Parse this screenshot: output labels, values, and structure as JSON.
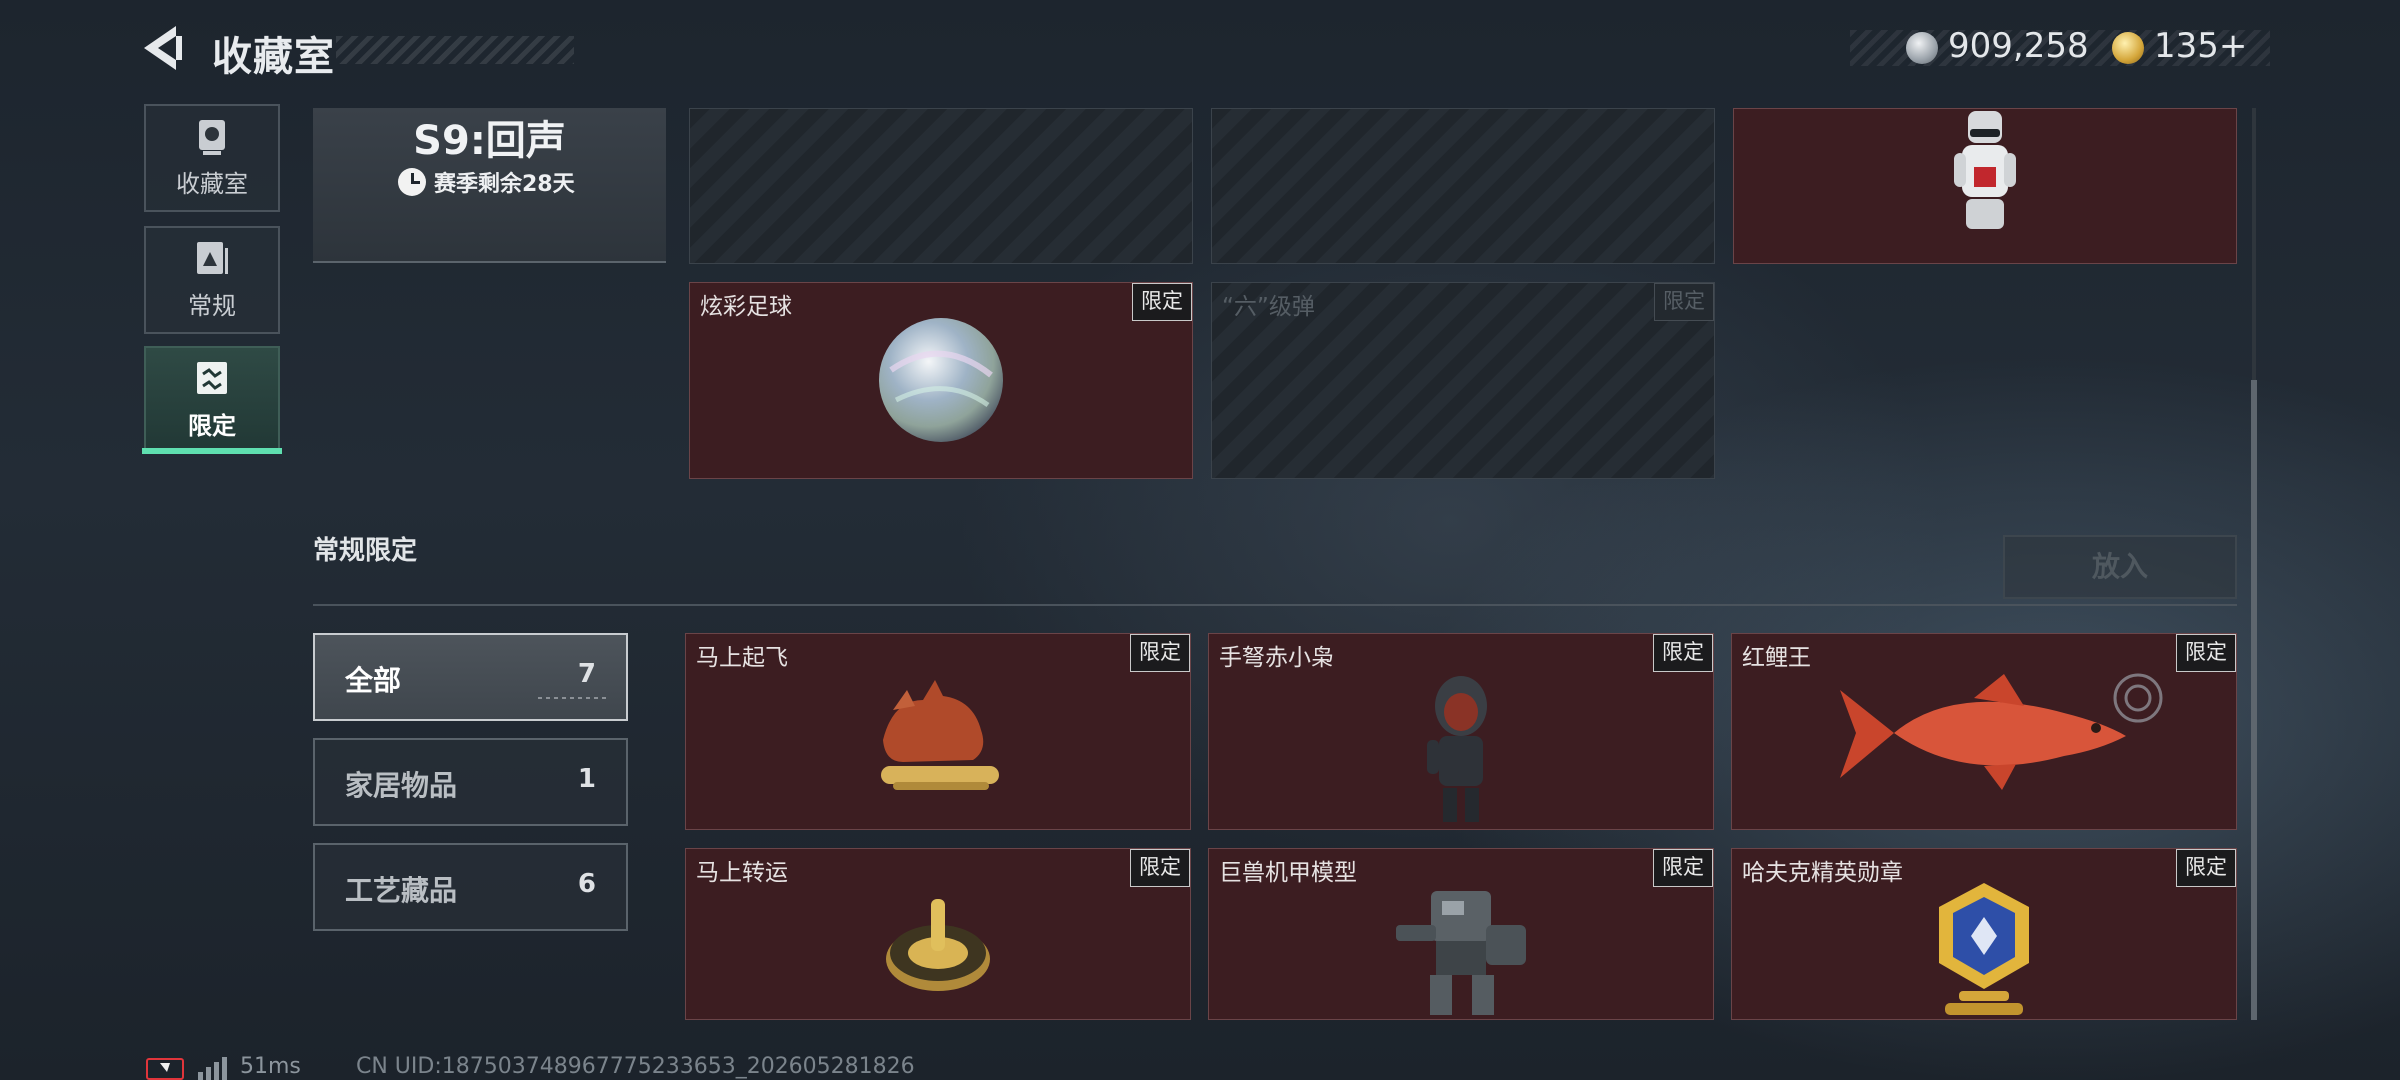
{
  "header": {
    "title": "收藏室"
  },
  "currency": {
    "silver": {
      "icon": "silver-coin-icon",
      "value": "909,258"
    },
    "gold": {
      "icon": "gold-coin-icon",
      "value": "135",
      "plus": "+"
    }
  },
  "nav": {
    "items": [
      {
        "label": "收藏室",
        "icon": "trophy-cup-icon"
      },
      {
        "label": "常规",
        "icon": "card-stack-icon"
      },
      {
        "label": "限定",
        "icon": "limited-card-icon"
      }
    ],
    "active_index": 2
  },
  "season": {
    "title": "S9:回声",
    "remaining": "赛季剩余28天"
  },
  "season_items": [
    {
      "name": "",
      "state": "locked"
    },
    {
      "name": "",
      "state": "locked"
    },
    {
      "name": "",
      "state": "owned",
      "art": "chef-robot-figure"
    },
    {
      "name": "炫彩足球",
      "badge": "限定",
      "state": "owned",
      "art": "iridescent-ball"
    },
    {
      "name": "“六”级弹",
      "badge": "限定",
      "state": "locked"
    }
  ],
  "section": {
    "title": "常规限定",
    "put_button": "放入"
  },
  "filters": [
    {
      "label": "全部",
      "count": "7",
      "active": true
    },
    {
      "label": "家居物品",
      "count": "1",
      "active": false
    },
    {
      "label": "工艺藏品",
      "count": "6",
      "active": false
    }
  ],
  "collection_items": [
    {
      "name": "马上起飞",
      "badge": "限定",
      "art": "copper-horse"
    },
    {
      "name": "手弩赤小枭",
      "badge": "限定",
      "art": "hooded-figure"
    },
    {
      "name": "红鲤王",
      "badge": "限定",
      "art": "red-carp"
    },
    {
      "name": "马上转运",
      "badge": "限定",
      "art": "golden-compass"
    },
    {
      "name": "巨兽机甲模型",
      "badge": "限定",
      "art": "mech-model"
    },
    {
      "name": "哈夫克精英勋章",
      "badge": "限定",
      "art": "gold-medal"
    }
  ],
  "footer": {
    "ping": "51ms",
    "uid": "CN UID:18750374896777523365​3_202605281826"
  },
  "colors": {
    "accent": "#5fe0b0",
    "card_red": "#3c1d21",
    "badge_bg": "#1b1b1d"
  }
}
